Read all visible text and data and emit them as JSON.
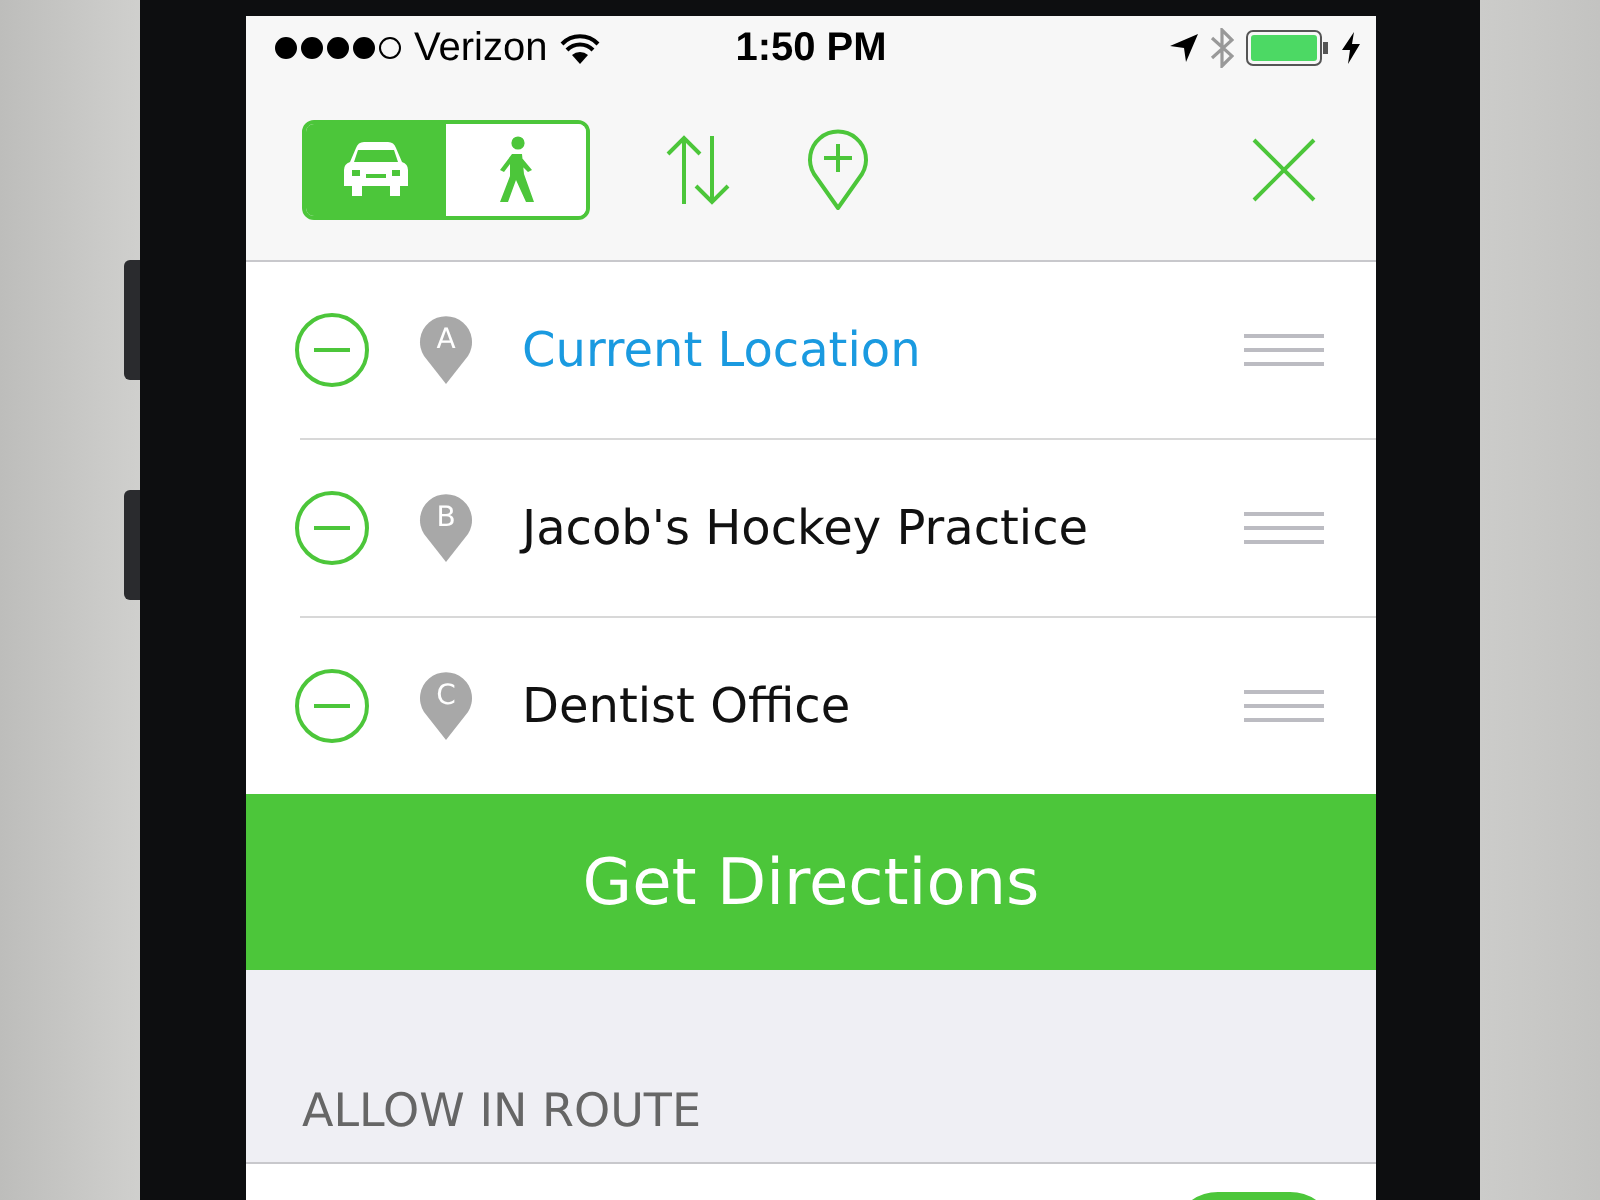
{
  "status_bar": {
    "carrier": "Verizon",
    "time": "1:50 PM"
  },
  "toolbar": {
    "modes": [
      {
        "kind": "car",
        "selected": true
      },
      {
        "kind": "walk",
        "selected": false
      }
    ]
  },
  "stops": [
    {
      "letter": "A",
      "name": "Current Location",
      "kind": "current"
    },
    {
      "letter": "B",
      "name": "Jacob's Hockey Practice",
      "kind": "place"
    },
    {
      "letter": "C",
      "name": "Dentist Office",
      "kind": "place"
    }
  ],
  "primary_button": "Get Directions",
  "section": {
    "header": "ALLOW IN ROUTE",
    "toggles": [
      {
        "on": true
      }
    ]
  }
}
